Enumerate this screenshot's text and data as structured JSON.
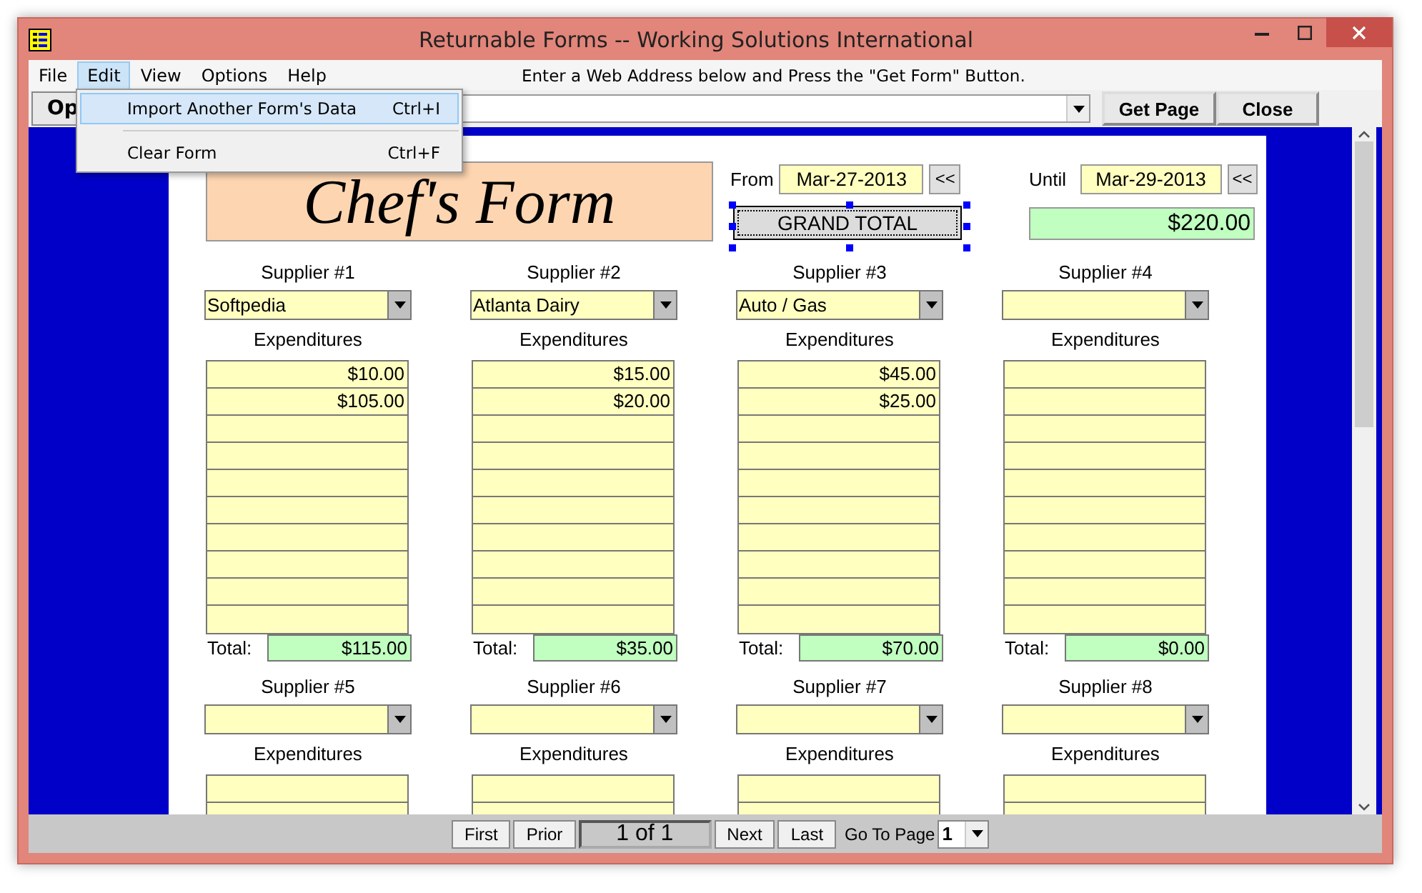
{
  "window": {
    "title": "Returnable Forms -- Working Solutions International"
  },
  "menu": [
    {
      "label": "File",
      "selected": false
    },
    {
      "label": "Edit",
      "selected": true
    },
    {
      "label": "View",
      "selected": false
    },
    {
      "label": "Options",
      "selected": false
    },
    {
      "label": "Help",
      "selected": false
    }
  ],
  "instruction": "Enter a Web Address below and Press the \"Get Form\" Button.",
  "dropdown_menu": [
    {
      "label": "Import Another Form's Data",
      "shortcut": "Ctrl+I",
      "selected": true
    },
    {
      "label": "Clear Form",
      "shortcut": "Ctrl+F",
      "selected": false
    }
  ],
  "toolbar": {
    "open_button": "Op",
    "get_page_button": "Get Page",
    "close_button": "Close"
  },
  "form": {
    "title": "Chef's Form",
    "from_label": "From",
    "from_date": "Mar-27-2013",
    "from_button": "<<",
    "until_label": "Until",
    "until_date": "Mar-29-2013",
    "until_button": "<<",
    "grand_total_button": {
      "label": "GRAND TOTAL",
      "selected": true
    },
    "grand_total": "$220.00",
    "suppliers": [
      {
        "label": "Supplier #1",
        "name": "Softpedia",
        "heading": "Expenditures",
        "amounts": [
          "$10.00",
          "$105.00"
        ],
        "total_label": "Total:",
        "total": "$115.00"
      },
      {
        "label": "Supplier #2",
        "name": "Atlanta Dairy",
        "heading": "Expenditures",
        "amounts": [
          "$15.00",
          "$20.00"
        ],
        "total_label": "Total:",
        "total": "$35.00"
      },
      {
        "label": "Supplier #3",
        "name": "Auto / Gas",
        "heading": "Expenditures",
        "amounts": [
          "$45.00",
          "$25.00"
        ],
        "total_label": "Total:",
        "total": "$70.00"
      },
      {
        "label": "Supplier #4",
        "heading": "Expenditures",
        "total_label": "Total:",
        "total": "$0.00"
      },
      {
        "label": "Supplier #5",
        "heading": "Expenditures"
      },
      {
        "label": "Supplier #6",
        "heading": "Expenditures"
      },
      {
        "label": "Supplier #7",
        "heading": "Expenditures"
      },
      {
        "label": "Supplier #8",
        "heading": "Expenditures"
      }
    ]
  },
  "navigation": {
    "first": "First",
    "prior": "Prior",
    "position": "1 of 1",
    "next": "Next",
    "last": "Last",
    "go_to_label": "Go To Page",
    "page": "1"
  }
}
